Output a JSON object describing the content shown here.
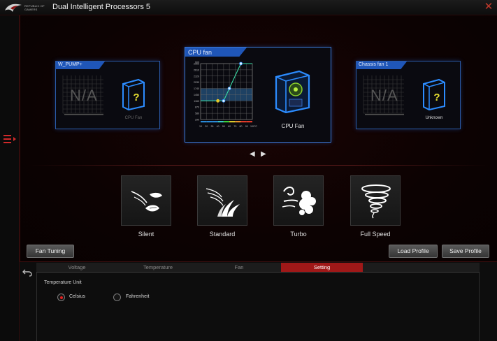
{
  "app": {
    "logo_text": "REPUBLIC OF GAMERS",
    "title": "Dual Intelligent Processors 5",
    "brand_color": "#c0392b",
    "accent_blue": "#1f56b8"
  },
  "fan_cards": {
    "left": {
      "header": "W_PUMP+",
      "status": "N/A",
      "fan_label": "CPU Fan"
    },
    "center": {
      "header": "CPU fan",
      "fan_label": "CPU Fan",
      "y_unit": "rpm",
      "x_unit": "°C",
      "y_ticks": [
        "2900",
        "2610",
        "2320",
        "2030",
        "1740",
        "1450",
        "1160",
        "870",
        "580",
        "290"
      ],
      "x_ticks": [
        "10",
        "20",
        "30",
        "40",
        "50",
        "60",
        "70",
        "80",
        "90",
        "100"
      ]
    },
    "right": {
      "header": "Chassis fan 1",
      "status": "N/A",
      "fan_label": "Unknown"
    }
  },
  "fan_curve": {
    "points": [
      {
        "temp": 40,
        "rpm": 1160
      },
      {
        "temp": 50,
        "rpm": 1160
      },
      {
        "temp": 60,
        "rpm": 1740
      },
      {
        "temp": 80,
        "rpm": 2900
      },
      {
        "temp": 100,
        "rpm": 2900
      }
    ]
  },
  "modes": [
    {
      "label": "Silent",
      "icon": "silent-leaves-icon"
    },
    {
      "label": "Standard",
      "icon": "standard-grass-icon"
    },
    {
      "label": "Turbo",
      "icon": "turbo-wind-icon"
    },
    {
      "label": "Full Speed",
      "icon": "full-speed-tornado-icon"
    }
  ],
  "buttons": {
    "fan_tuning": "Fan Tuning",
    "load_profile": "Load Profile",
    "save_profile": "Save Profile"
  },
  "tabs": [
    {
      "label": "Voltage",
      "active": false
    },
    {
      "label": "Temperature",
      "active": false
    },
    {
      "label": "Fan",
      "active": false
    },
    {
      "label": "Setting",
      "active": true
    }
  ],
  "settings": {
    "section_label": "Temperature Unit",
    "options": [
      {
        "label": "Celsius",
        "selected": true
      },
      {
        "label": "Fahrenheit",
        "selected": false
      }
    ]
  }
}
